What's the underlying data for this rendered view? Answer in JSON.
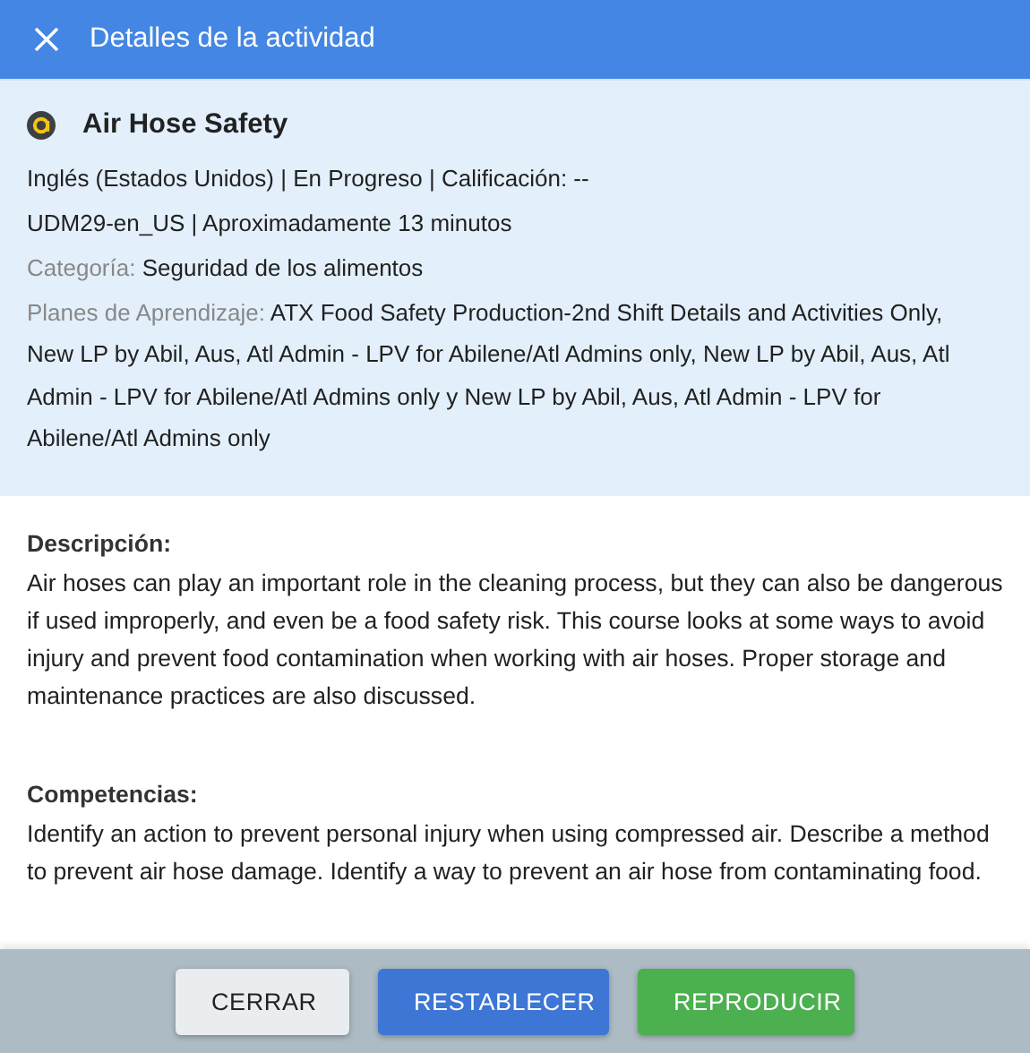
{
  "header": {
    "title": "Detalles de la actividad"
  },
  "activity": {
    "title": "Air Hose Safety",
    "meta_lines": [
      "Inglés (Estados Unidos) | En Progreso | Calificación: --",
      "UDM29-en_US | Aproximadamente 13 minutos"
    ],
    "fields": [
      {
        "label": "Categoría:",
        "value": "Seguridad de los alimentos"
      },
      {
        "label": "Planes de Aprendizaje:",
        "value": "ATX Food Safety Production-2nd Shift Details and Activities Only, New LP by Abil, Aus, Atl Admin - LPV for Abilene/Atl Admins only, New LP by Abil, Aus, Atl Admin - LPV for Abilene/Atl Admins only y New LP by Abil, Aus, Atl Admin - LPV for Abilene/Atl Admins only"
      }
    ]
  },
  "sections": [
    {
      "heading": "Descripción:",
      "body": "Air hoses can play an important role in the cleaning process, but they can also be dangerous if used improperly, and even be a food safety risk. This course looks at some ways to avoid injury and prevent food contamination when working with air hoses. Proper storage and maintenance practices are also discussed."
    },
    {
      "heading": "Competencias:",
      "body": "Identify an action to prevent personal injury when using compressed air. Describe a method to prevent air hose damage. Identify a way to prevent an air hose from contaminating food."
    }
  ],
  "buttons": [
    {
      "label": "CERRAR",
      "kind": "secondary"
    },
    {
      "label": "RESTABLECER",
      "kind": "primary"
    },
    {
      "label": "REPRODUCIR",
      "kind": "success"
    }
  ]
}
